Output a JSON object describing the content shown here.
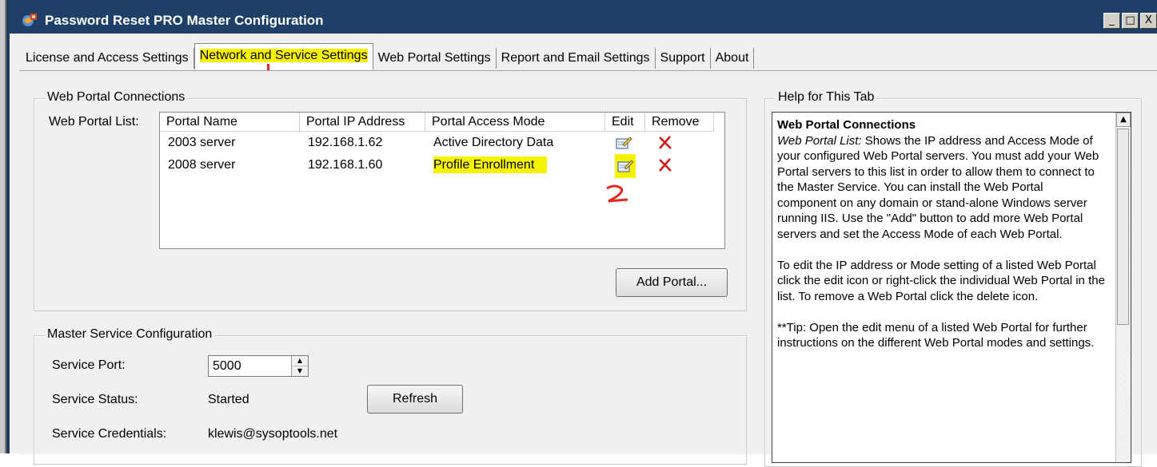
{
  "window": {
    "title": "Password Reset PRO Master Configuration",
    "caption_buttons": [
      "_",
      "□",
      "X"
    ]
  },
  "tabs": [
    {
      "label": "License and Access Settings",
      "active": false
    },
    {
      "label": "Network and Service Settings",
      "active": true
    },
    {
      "label": "Web Portal Settings",
      "active": false
    },
    {
      "label": "Report and Email Settings",
      "active": false
    },
    {
      "label": "Support",
      "active": false
    },
    {
      "label": "About",
      "active": false
    }
  ],
  "annotations": {
    "mark_1": "1",
    "mark_2": "2",
    "highlight_color": "#f6f200",
    "annotation_color": "#e8261c"
  },
  "web_portal_connections": {
    "title": "Web Portal Connections",
    "list_label": "Web Portal List:",
    "columns": [
      "Portal Name",
      "Portal IP Address",
      "Portal Access Mode",
      "Edit",
      "Remove"
    ],
    "rows": [
      {
        "name": "2003 server",
        "ip": "192.168.1.62",
        "mode": "Active Directory Data",
        "edit_icon": "edit-icon",
        "remove_icon": "delete-icon"
      },
      {
        "name": "2008 server",
        "ip": "192.168.1.60",
        "mode": "Profile Enrollment",
        "edit_icon": "edit-icon",
        "remove_icon": "delete-icon"
      }
    ],
    "add_button": "Add Portal..."
  },
  "master_service": {
    "title": "Master Service Configuration",
    "port_label": "Service Port:",
    "port_value": "5000",
    "status_label": "Service Status:",
    "status_value": "Started",
    "refresh_button": "Refresh",
    "credentials_label": "Service Credentials:",
    "credentials_value": "klewis@sysoptools.net"
  },
  "help": {
    "group_title": "Help for This Tab",
    "heading": "Web Portal Connections",
    "para1_italic": "Web Portal List:",
    "para1": "  Shows the IP address and Access Mode of your configured Web Portal servers. You must add your Web Portal servers to this list in order to allow them to connect to the Master Service. You can install the Web Portal component on any domain or stand-alone Windows server running IIS.  Use the \"Add\" button to add more Web Portal servers and set the Access Mode of each Web Portal.",
    "para2": "To edit the IP address or Mode setting of a listed Web Portal click the edit icon or right-click the individual Web Portal in the list. To remove a Web Portal click the delete icon.",
    "para3": "**Tip: Open the edit menu of a listed Web Portal for further instructions on the different Web Portal modes and settings."
  }
}
